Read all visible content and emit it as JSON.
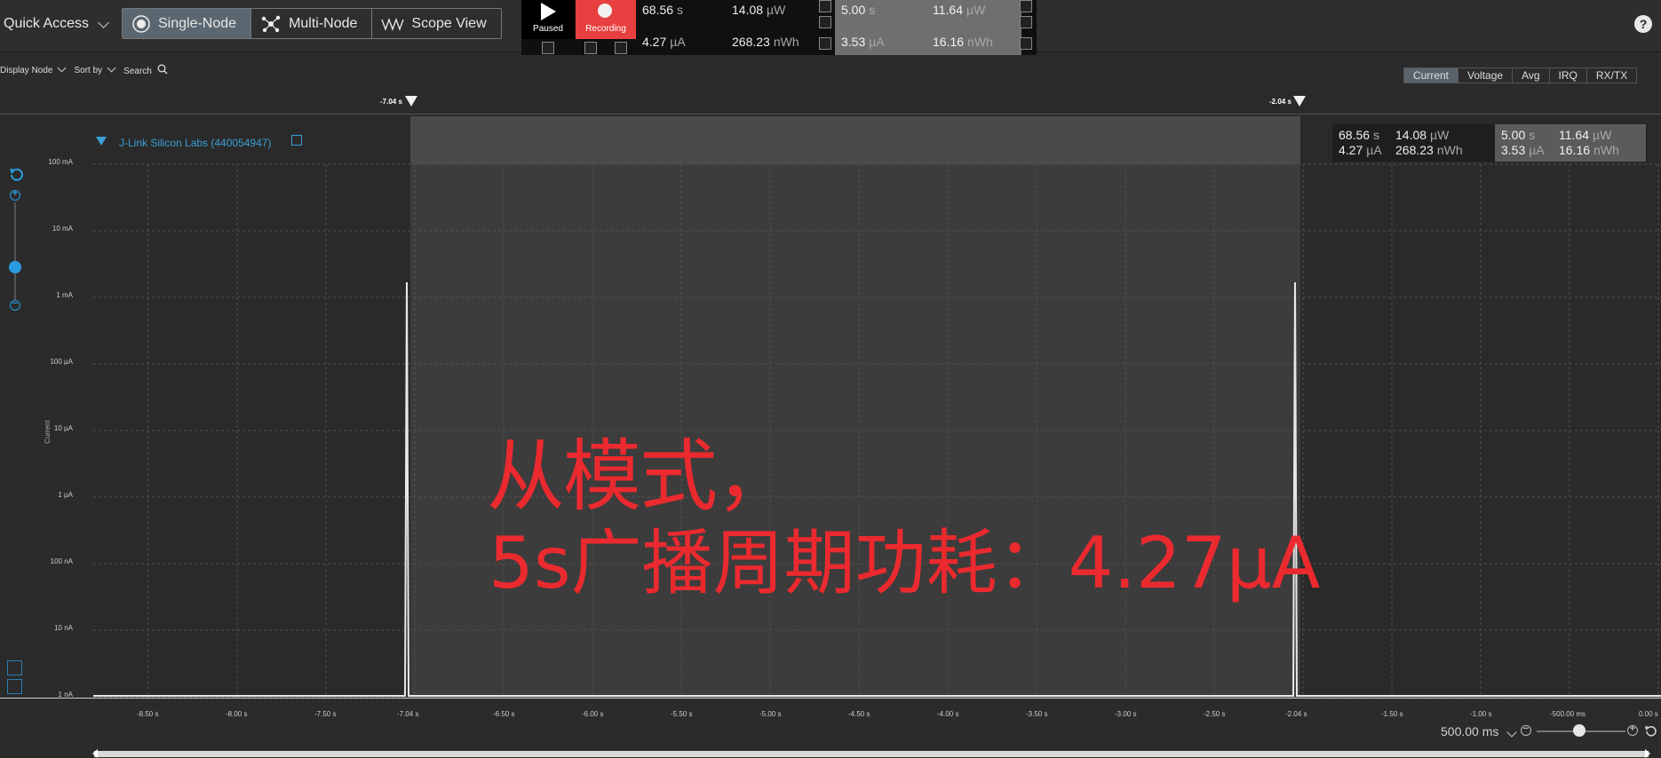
{
  "toolbar": {
    "quick_access": "Quick Access",
    "modes": [
      {
        "label": "Single-Node",
        "icon": "single-node-icon",
        "active": true
      },
      {
        "label": "Multi-Node",
        "icon": "multi-node-icon",
        "active": false
      },
      {
        "label": "Scope View",
        "icon": "scope-view-icon",
        "active": false
      }
    ],
    "paused_label": "Paused",
    "recording_label": "Recording",
    "readouts": {
      "time": "68.56",
      "time_unit": "s",
      "power": "14.08",
      "power_unit": "µW",
      "current": "4.27",
      "current_unit": "µA",
      "energy": "268.23",
      "energy_unit": "nWh"
    },
    "compare": {
      "time": "5.00",
      "time_unit": "s",
      "power": "11.64",
      "power_unit": "µW",
      "current": "3.53",
      "current_unit": "µA",
      "energy": "16.16",
      "energy_unit": "nWh"
    },
    "help": "?"
  },
  "subbar": {
    "display_node": "Display Node",
    "sort_by": "Sort by",
    "search": "Search",
    "view_tabs": [
      "Current",
      "Voltage",
      "Avg",
      "IRQ",
      "RX/TX"
    ],
    "active_tab": "Current"
  },
  "markers": {
    "left": "-7.04 s",
    "right": "-2.04 s"
  },
  "plot": {
    "device": "J-Link Silicon Labs (440054947)",
    "y_title": "Current",
    "readouts": {
      "time": "68.56",
      "time_unit": "s",
      "power": "14.08",
      "power_unit": "µW",
      "current": "4.27",
      "current_unit": "µA",
      "energy": "268.23",
      "energy_unit": "nWh",
      "c_time": "5.00",
      "c_time_unit": "s",
      "c_power": "11.64",
      "c_power_unit": "µW",
      "c_current": "3.53",
      "c_current_unit": "µA",
      "c_energy": "16.16",
      "c_energy_unit": "nWh"
    },
    "y_labels": [
      "100 mA",
      "10 mA",
      "1 mA",
      "100 µA",
      "10 µA",
      "1 µA",
      "100 nA",
      "10 nA",
      "1 nA"
    ],
    "x_labels": [
      "-8.50 s",
      "-8.00 s",
      "-7.50 s",
      "-7.04 s",
      "-6.50 s",
      "-6.00 s",
      "-5.50 s",
      "-5.00 s",
      "-4.50 s",
      "-4.00 s",
      "-3.50 s",
      "-3.00 s",
      "-2.50 s",
      "-2.04 s",
      "-1.50 s",
      "-1.00 s",
      "-500.00 ms",
      "0.00 s"
    ],
    "overlay_line1": "从模式，",
    "overlay_line2": "5s广播周期功耗：4.27μA",
    "zoom_label": "500.00 ms"
  },
  "colors": {
    "accent": "#2a9de0",
    "recording": "#e84040",
    "overlay": "#ea2a2f",
    "device": "#3a9fd6"
  }
}
